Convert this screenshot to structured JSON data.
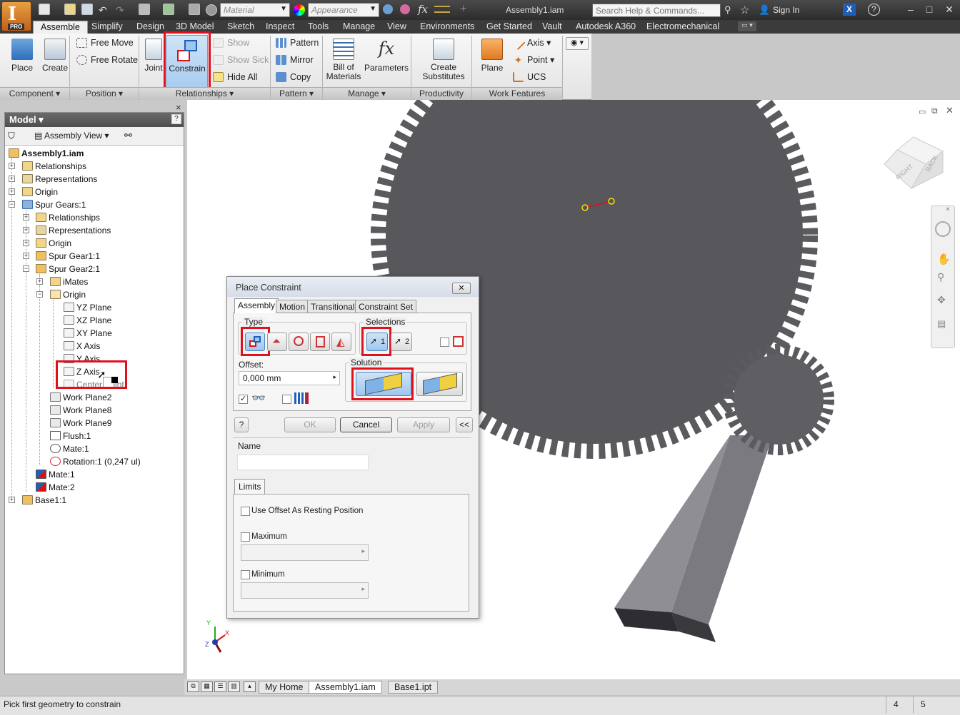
{
  "app": {
    "badge": "PRO",
    "doc_title": "Assembly1.iam"
  },
  "quick_access": {
    "material_combo": "Material",
    "appearance_combo": "Appearance"
  },
  "search": {
    "placeholder": "Search Help & Commands..."
  },
  "account": {
    "sign_in": "Sign In"
  },
  "tabs": [
    "Assemble",
    "Simplify",
    "Design",
    "3D Model",
    "Sketch",
    "Inspect",
    "Tools",
    "Manage",
    "View",
    "Environments",
    "Get Started",
    "Vault",
    "Autodesk A360",
    "Electromechanical"
  ],
  "ribbon": {
    "component": {
      "label": "Component",
      "place": "Place",
      "create": "Create"
    },
    "position": {
      "label": "Position",
      "free_move": "Free Move",
      "free_rotate": "Free Rotate"
    },
    "relationships": {
      "label": "Relationships",
      "joint": "Joint",
      "constrain": "Constrain",
      "show": "Show",
      "show_sick": "Show Sick",
      "hide_all": "Hide All"
    },
    "pattern": {
      "label": "Pattern",
      "pattern": "Pattern",
      "mirror": "Mirror",
      "copy": "Copy"
    },
    "manage": {
      "label": "Manage",
      "bom_line1": "Bill of",
      "bom_line2": "Materials",
      "parameters": "Parameters"
    },
    "productivity": {
      "label": "Productivity",
      "create_sub_line1": "Create",
      "create_sub_line2": "Substitutes"
    },
    "work_features": {
      "label": "Work Features",
      "plane": "Plane",
      "axis": "Axis",
      "point": "Point",
      "ucs": "UCS"
    }
  },
  "browser": {
    "title": "Model",
    "view": "Assembly View",
    "tree": [
      {
        "label": "Assembly1.iam",
        "bold": true
      },
      {
        "label": "Relationships"
      },
      {
        "label": "Representations"
      },
      {
        "label": "Origin"
      },
      {
        "label": "Spur Gears:1"
      },
      {
        "label": "Relationships"
      },
      {
        "label": "Representations"
      },
      {
        "label": "Origin"
      },
      {
        "label": "Spur Gear1:1"
      },
      {
        "label": "Spur Gear2:1"
      },
      {
        "label": "iMates"
      },
      {
        "label": "Origin"
      },
      {
        "label": "YZ Plane"
      },
      {
        "label": "XZ Plane"
      },
      {
        "label": "XY Plane"
      },
      {
        "label": "X Axis"
      },
      {
        "label": "Y Axis"
      },
      {
        "label": "Z Axis"
      },
      {
        "label": "Center Point"
      },
      {
        "label": "Work Plane2"
      },
      {
        "label": "Work Plane8"
      },
      {
        "label": "Work Plane9"
      },
      {
        "label": "Flush:1"
      },
      {
        "label": "Mate:1"
      },
      {
        "label": "Rotation:1 (0,247 ul)"
      },
      {
        "label": "Mate:1"
      },
      {
        "label": "Mate:2"
      },
      {
        "label": "Base1:1"
      }
    ]
  },
  "dialog": {
    "title": "Place Constraint",
    "tabs": [
      "Assembly",
      "Motion",
      "Transitional",
      "Constraint Set"
    ],
    "type_label": "Type",
    "selections_label": "Selections",
    "sel1": "1",
    "sel2": "2",
    "offset_label": "Offset:",
    "offset_value": "0,000 mm",
    "solution_label": "Solution",
    "ok": "OK",
    "cancel": "Cancel",
    "apply": "Apply",
    "expand": "<<",
    "name_label": "Name",
    "limits_tab": "Limits",
    "use_offset": "Use Offset As Resting Position",
    "maximum": "Maximum",
    "minimum": "Minimum"
  },
  "viewcube": {
    "right": "RIGHT",
    "back": "BACK"
  },
  "triad": {
    "x": "X",
    "y": "Y",
    "z": "Z"
  },
  "doc_tabs": [
    "My Home",
    "Assembly1.iam",
    "Base1.ipt"
  ],
  "status": {
    "message": "Pick first geometry to constrain",
    "n1": "4",
    "n2": "5"
  },
  "colors": {
    "highlight": "#e0101f",
    "gear": "#5a5a5f",
    "ribbon_selected": "#a9cdf0"
  }
}
